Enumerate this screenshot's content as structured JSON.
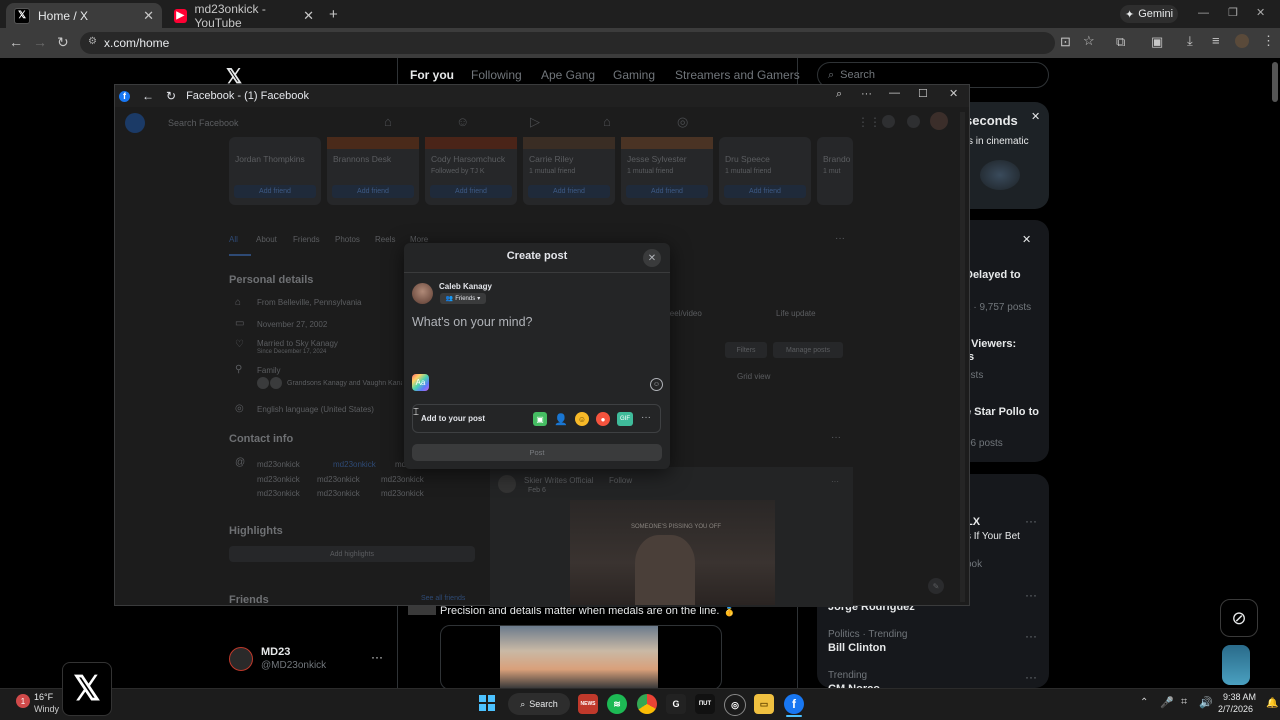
{
  "browser": {
    "tabs": [
      {
        "title": "Home / X",
        "icon": "x-logo-icon"
      },
      {
        "title": "md23onkick - YouTube",
        "icon": "youtube-icon"
      }
    ],
    "gemini_label": "Gemini",
    "url": "x.com/home"
  },
  "x": {
    "tabs": [
      "For you",
      "Following",
      "Ape Gang",
      "Gaming",
      "Streamers and Gamers"
    ],
    "search_placeholder": "Search",
    "promo_title": "seconds",
    "promo_sub": "s in cinematic",
    "trends": [
      {
        "title": "Delayed to",
        "meta": "1 · 9,757 posts"
      },
      {
        "title": "l Viewers:",
        "title2": "ls",
        "meta": "osts"
      },
      {
        "title": "e Star Pollo to",
        "meta": "06 posts"
      }
    ],
    "trends2": [
      {
        "title": "LX",
        "sub": "s If Your Bet",
        "meta": "ook"
      },
      {
        "title": "Jorge Rodríguez"
      },
      {
        "cat": "Politics · Trending",
        "title": "Bill Clinton"
      },
      {
        "cat": "Trending",
        "title": "CM Norco"
      }
    ],
    "post_text": "Precision and details matter when medals are on the line. 🥇",
    "account": {
      "name": "MD23",
      "handle": "@MD23onkick"
    }
  },
  "fbwindow": {
    "title": "Facebook - (1) Facebook",
    "search_placeholder": "Search Facebook",
    "friends": [
      {
        "name": "Jordan Thompkins",
        "meta": ""
      },
      {
        "name": "Brannons Desk",
        "meta": ""
      },
      {
        "name": "Cody Harsomchuck",
        "meta": "Followed by TJ K"
      },
      {
        "name": "Carrie Riley",
        "meta": "1 mutual friend"
      },
      {
        "name": "Jesse Sylvester",
        "meta": "1 mutual friend"
      },
      {
        "name": "Dru Speece",
        "meta": "1 mutual friend"
      },
      {
        "name": "Brando",
        "meta": "1 mut"
      }
    ],
    "add_friend": "Add friend",
    "profile_tabs": [
      "All",
      "About",
      "Friends",
      "Photos",
      "Reels",
      "More"
    ],
    "personal_details_heading": "Personal details",
    "details": [
      "From Belleville, Pennsylvania",
      "November 27, 2002",
      "Married to Sky Kanagy",
      "Family",
      "English language (United States)"
    ],
    "married_since": "Since December 17, 2024",
    "family_text": "Grandsons Kanagy and Vaughn Kana",
    "contact_heading": "Contact info",
    "contact_handles": [
      "md23onkick",
      "md23onkick",
      "md23onkick",
      "md23onkick",
      "md23onkick",
      "md23onkick",
      "md23onkick",
      "md23onkick",
      "md23onkick"
    ],
    "highlights_heading": "Highlights",
    "add_highlights": "Add highlights",
    "friends_heading": "Friends",
    "see_all_friends": "See all friends",
    "life_update": "Life update",
    "reel_video": "Reel/video",
    "filters": "Filters",
    "manage_posts": "Manage posts",
    "grid_view": "Grid view",
    "feed_post_author": "Skier Writes Official",
    "feed_post_follow": "Follow",
    "feed_post_date": "Feb 6",
    "video_caption": "SOMEONE'S PISSING YOU OFF"
  },
  "dialog": {
    "title": "Create post",
    "user_name": "Caleb Kanagy",
    "audience": "Friends",
    "placeholder": "What's on your mind?",
    "add_to_post": "Add to your post",
    "post_button": "Post",
    "gif_label": "GIF"
  },
  "taskbar": {
    "weather_temp": "16°F",
    "weather_desc": "Windy",
    "search_label": "Search",
    "time": "9:38 AM",
    "date": "2/7/2026"
  },
  "colors": {
    "fb_blue": "#1877f2",
    "x_bg": "#000000",
    "dialog_bg": "#242526"
  }
}
